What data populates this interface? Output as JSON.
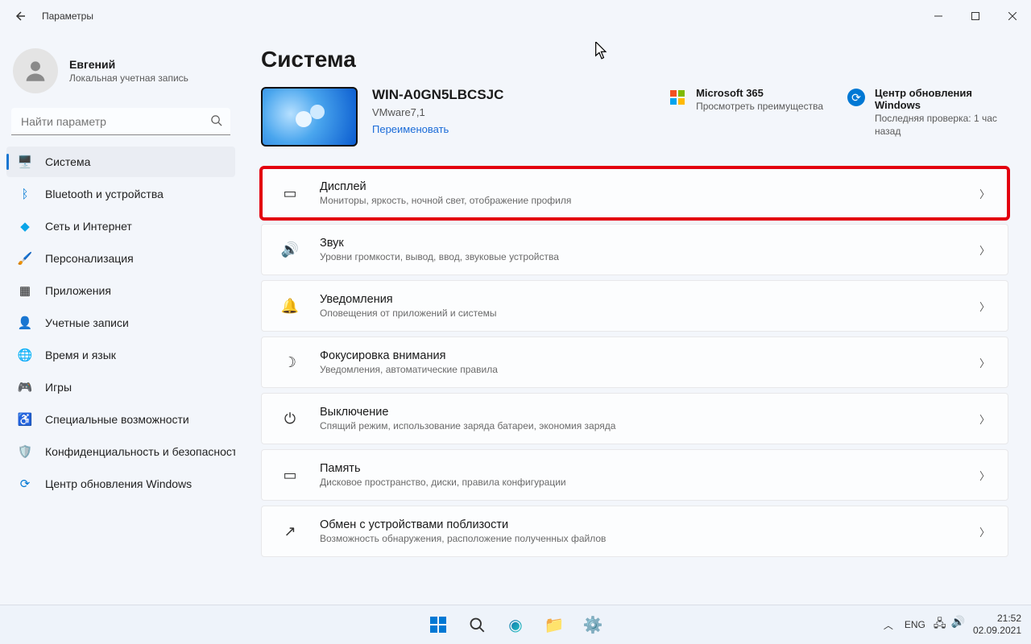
{
  "titlebar": {
    "title": "Параметры"
  },
  "user": {
    "name": "Евгений",
    "account": "Локальная учетная запись"
  },
  "search": {
    "placeholder": "Найти параметр"
  },
  "sidebar": {
    "items": [
      {
        "label": "Система"
      },
      {
        "label": "Bluetooth и устройства"
      },
      {
        "label": "Сеть и Интернет"
      },
      {
        "label": "Персонализация"
      },
      {
        "label": "Приложения"
      },
      {
        "label": "Учетные записи"
      },
      {
        "label": "Время и язык"
      },
      {
        "label": "Игры"
      },
      {
        "label": "Специальные возможности"
      },
      {
        "label": "Конфиденциальность и безопасность"
      },
      {
        "label": "Центр обновления Windows"
      }
    ]
  },
  "page": {
    "title": "Система",
    "device": {
      "name": "WIN-A0GN5LBCSJC",
      "model": "VMware7,1",
      "rename": "Переименовать"
    },
    "quick": {
      "ms365": {
        "title": "Microsoft 365",
        "sub": "Просмотреть преимущества"
      },
      "update": {
        "title": "Центр обновления Windows",
        "sub": "Последняя проверка: 1 час назад"
      }
    },
    "settings": [
      {
        "title": "Дисплей",
        "sub": "Мониторы, яркость, ночной свет, отображение профиля",
        "highlight": true
      },
      {
        "title": "Звук",
        "sub": "Уровни громкости, вывод, ввод, звуковые устройства"
      },
      {
        "title": "Уведомления",
        "sub": "Оповещения от приложений и системы"
      },
      {
        "title": "Фокусировка внимания",
        "sub": "Уведомления, автоматические правила"
      },
      {
        "title": "Выключение",
        "sub": "Спящий режим, использование заряда батареи, экономия заряда"
      },
      {
        "title": "Память",
        "sub": "Дисковое пространство, диски, правила конфигурации"
      },
      {
        "title": "Обмен с устройствами поблизости",
        "sub": "Возможность обнаружения, расположение полученных файлов"
      }
    ]
  },
  "taskbar": {
    "lang": "ENG",
    "time": "21:52",
    "date": "02.09.2021"
  }
}
